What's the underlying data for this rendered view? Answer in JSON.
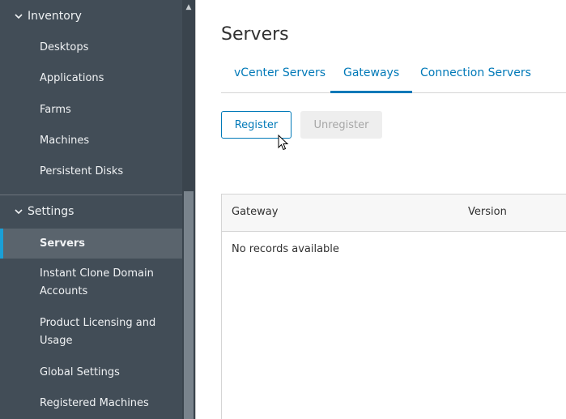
{
  "sidebar": {
    "groups": [
      {
        "label": "Inventory",
        "items": [
          "Desktops",
          "Applications",
          "Farms",
          "Machines",
          "Persistent Disks"
        ]
      },
      {
        "label": "Settings",
        "items": [
          "Servers",
          "Instant Clone Domain Accounts",
          "Product Licensing and Usage",
          "Global Settings",
          "Registered Machines"
        ],
        "active_item": "Servers"
      }
    ]
  },
  "main": {
    "title": "Servers",
    "tabs": [
      {
        "label": "vCenter Servers",
        "active": false
      },
      {
        "label": "Gateways",
        "active": true
      },
      {
        "label": "Connection Servers",
        "active": false
      }
    ],
    "buttons": {
      "register": "Register",
      "unregister": "Unregister"
    },
    "grid": {
      "columns": [
        "Gateway",
        "Version"
      ],
      "empty_message": "No records available"
    }
  },
  "colors": {
    "sidebar_bg": "#424d57",
    "accent": "#0079b8",
    "active_indicator": "#1a9fd6"
  }
}
